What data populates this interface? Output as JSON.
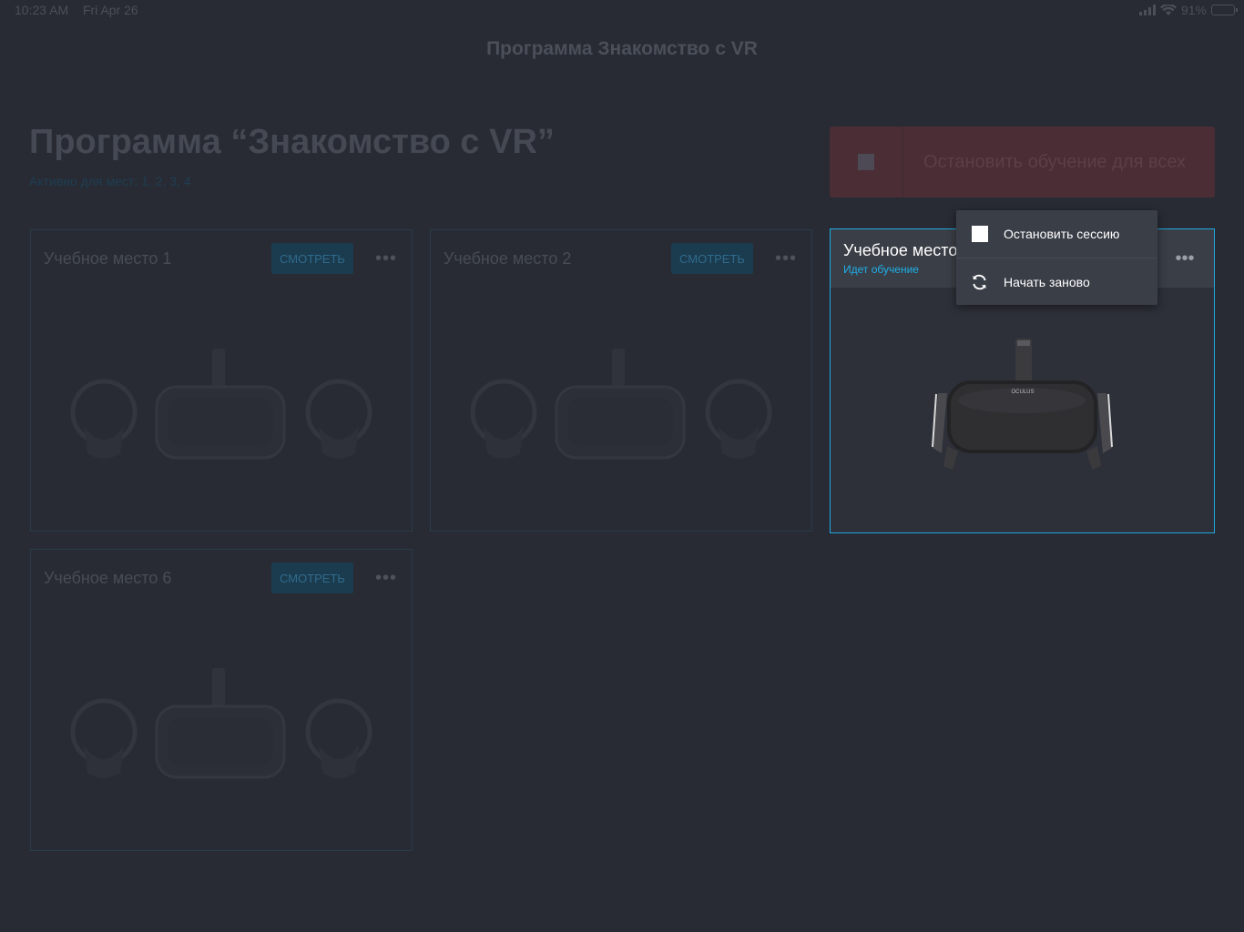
{
  "status_bar": {
    "time": "10:23 AM",
    "date": "Fri Apr 26",
    "battery": "91%",
    "battery_level": 0.91
  },
  "nav": {
    "title": "Программа Знакомство с VR"
  },
  "header": {
    "title": "Программа “Знакомство с VR”",
    "active_for": "Активно для мест: 1, 2, 3, 4",
    "stop_all_label": "Остановить обучение для всех"
  },
  "cards": [
    {
      "title": "Учебное место 1",
      "watch_label": "СМОТРЕТЬ",
      "more_label": "•••"
    },
    {
      "title": "Учебное место 2",
      "watch_label": "СМОТРЕТЬ",
      "more_label": "•••"
    },
    {
      "title": "Учебное место 6",
      "watch_label": "СМОТРЕТЬ",
      "more_label": "•••"
    }
  ],
  "active_card": {
    "title": "Учебное место",
    "status": "Идет обучение",
    "more_label": "•••",
    "brand": "OCULUS"
  },
  "context_menu": {
    "items": [
      {
        "label": "Остановить сессию",
        "icon": "stop-icon"
      },
      {
        "label": "Начать заново",
        "icon": "restart-icon"
      }
    ]
  },
  "colors": {
    "accent": "#1ea8e0",
    "background": "#282b34",
    "menu_bg": "#3a3e47",
    "stop_all_bg": "#4a2d35"
  }
}
